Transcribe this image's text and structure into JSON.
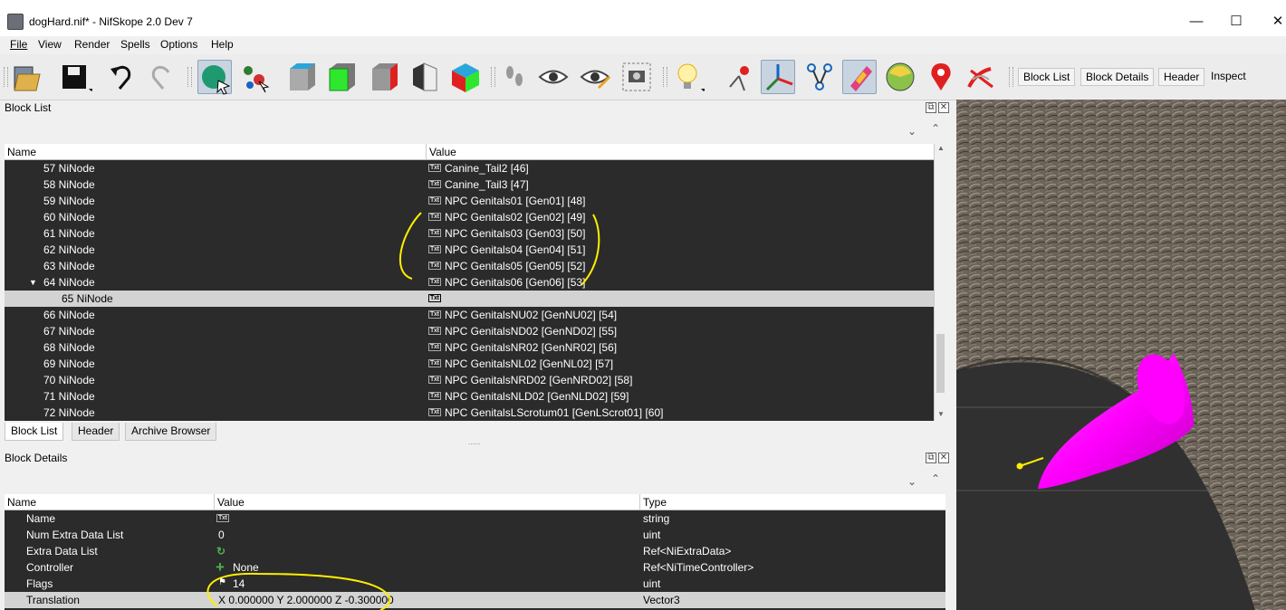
{
  "window": {
    "title": "dogHard.nif* - NifSkope 2.0 Dev 7",
    "minimize": "—",
    "maximize": "☐",
    "close": "✕"
  },
  "menu": [
    "File",
    "View",
    "Render",
    "Spells",
    "Options",
    "Help"
  ],
  "toolbar": {
    "text_buttons": [
      "Block List",
      "Block Details",
      "Header",
      "Inspect"
    ]
  },
  "block_list": {
    "title": "Block List",
    "columns": [
      "Name",
      "Value"
    ],
    "rows": [
      {
        "name": "57 NiNode",
        "value": "Canine_Tail2 [46]"
      },
      {
        "name": "58 NiNode",
        "value": "Canine_Tail3 [47]"
      },
      {
        "name": "59 NiNode",
        "value": "NPC Genitals01 [Gen01] [48]"
      },
      {
        "name": "60 NiNode",
        "value": "NPC Genitals02 [Gen02] [49]"
      },
      {
        "name": "61 NiNode",
        "value": "NPC Genitals03 [Gen03] [50]"
      },
      {
        "name": "62 NiNode",
        "value": "NPC Genitals04 [Gen04] [51]"
      },
      {
        "name": "63 NiNode",
        "value": "NPC Genitals05 [Gen05] [52]"
      },
      {
        "name": "64 NiNode",
        "value": "NPC Genitals06 [Gen06] [53]",
        "expanded": true
      },
      {
        "name": "65 NiNode",
        "value": "",
        "selected": true,
        "child": true
      },
      {
        "name": "66 NiNode",
        "value": "NPC GenitalsNU02 [GenNU02] [54]"
      },
      {
        "name": "67 NiNode",
        "value": "NPC GenitalsND02 [GenND02] [55]"
      },
      {
        "name": "68 NiNode",
        "value": "NPC GenitalsNR02 [GenNR02] [56]"
      },
      {
        "name": "69 NiNode",
        "value": "NPC GenitalsNL02 [GenNL02] [57]"
      },
      {
        "name": "70 NiNode",
        "value": "NPC GenitalsNRD02 [GenNRD02] [58]"
      },
      {
        "name": "71 NiNode",
        "value": "NPC GenitalsNLD02 [GenNLD02] [59]"
      },
      {
        "name": "72 NiNode",
        "value": "NPC GenitalsLScrotum01 [GenLScrot01] [60]"
      }
    ],
    "tabs": [
      "Block List",
      "Header",
      "Archive Browser"
    ]
  },
  "block_details": {
    "title": "Block Details",
    "columns": [
      "Name",
      "Value",
      "Type"
    ],
    "rows": [
      {
        "name": "Name",
        "value": "",
        "type": "string",
        "icon": "txt"
      },
      {
        "name": "Num Extra Data List",
        "value": "0",
        "type": "uint"
      },
      {
        "name": "Extra Data List",
        "value": "",
        "type": "Ref<NiExtraData>",
        "icon": "refresh"
      },
      {
        "name": "Controller",
        "value": "None",
        "type": "Ref<NiTimeController>",
        "icon": "plus"
      },
      {
        "name": "Flags",
        "value": "14",
        "type": "uint",
        "icon": "flag"
      },
      {
        "name": "Translation",
        "value": "X 0.000000 Y 2.000000 Z -0.300000",
        "type": "Vector3",
        "selected": true
      }
    ]
  },
  "icons": {
    "txt_label": "Txt",
    "expand_arrow": "▼",
    "chevron": "⌄",
    "dock_float": "⧉",
    "dock_close": "✕",
    "splitter": "......"
  },
  "colors": {
    "table_bg": "#2b2b2b",
    "selected_row": "#d3d3d3",
    "annotation": "#ffee00",
    "mesh_magenta": "#ff00ff"
  }
}
